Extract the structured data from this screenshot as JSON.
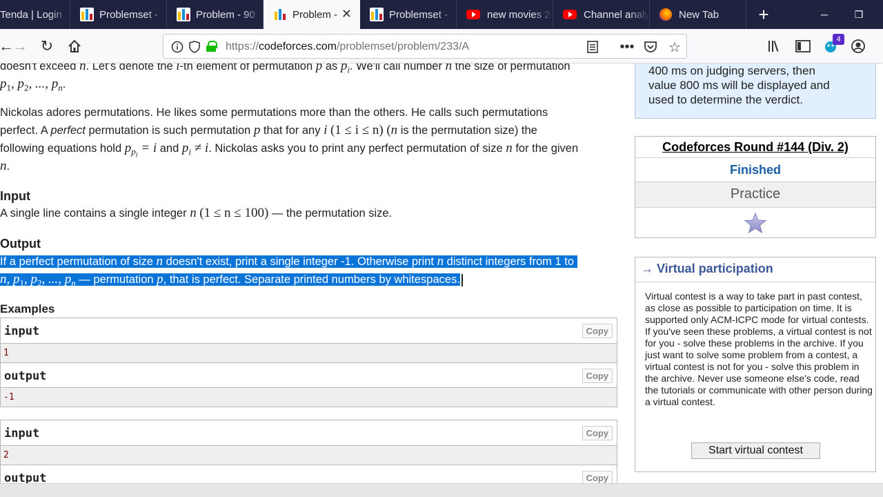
{
  "browser": {
    "tabs": [
      {
        "label": "Tenda | Login",
        "icon": "none"
      },
      {
        "label": "Problemset -",
        "icon": "codeforces-icon"
      },
      {
        "label": "Problem - 90",
        "icon": "codeforces-icon"
      },
      {
        "label": "Problem -",
        "icon": "codeforces-icon",
        "active": true
      },
      {
        "label": "Problemset -",
        "icon": "codeforces-icon"
      },
      {
        "label": "new movies 2",
        "icon": "youtube-icon"
      },
      {
        "label": "Channel analy",
        "icon": "youtube-icon"
      },
      {
        "label": "New Tab",
        "icon": "firefox-icon"
      }
    ],
    "url_prefix": "https://",
    "url_domain": "codeforces.com",
    "url_path": "/problemset/problem/233/A",
    "extension_badge": "4"
  },
  "problem": {
    "p1a_pre": "doesn't exceed",
    "p1a_n": "n",
    "p1a_mid": ". Let's denote the",
    "p1a_i": "i",
    "p1a_mid2": "-th element of permutation",
    "p1a_p": "p",
    "p1a_as": "as",
    "p1a_pi": "p",
    "p1a_sub_i": "i",
    "p1a_post": ". We'll call number",
    "p1a_n2": "n",
    "p1a_end": "the size of permutation",
    "p1b": "p",
    "p1b_1": "1",
    "p1b_comma": ", p",
    "p1b_2": "2",
    "p1b_dots": ", ..., p",
    "p1b_n": "n",
    "p1b_dot": ".",
    "p2_l1": "Nickolas adores permutations. He likes some permutations more than the others. He calls such permutations",
    "p2_l2_a": "perfect. A",
    "p2_l2_perfect": "perfect",
    "p2_l2_b": "permutation is such permutation",
    "p2_l2_p": "p",
    "p2_l2_c": "that for any",
    "p2_l2_i": "i",
    "p2_l2_cond": "(1 ≤ i ≤ n)",
    "p2_l2_d": "(",
    "p2_l2_n": "n",
    "p2_l2_e": "is the permutation size) the",
    "p2_l3_a": "following equations hold",
    "p2_l3_eq1": "p",
    "p2_l3_sub_p": "p",
    "p2_l3_sub_i": "i",
    "p2_l3_eq1b": " = i",
    "p2_l3_and": "and",
    "p2_l3_eq2": "p",
    "p2_l3_eq2_sub": "i",
    "p2_l3_eq2b": " ≠ i",
    "p2_l3_b": ". Nickolas asks you to print any perfect permutation of size",
    "p2_l3_n": "n",
    "p2_l3_c": "for the given",
    "p2_l4": "n",
    "p2_l4_dot": ".",
    "input_heading": "Input",
    "input_a": "A single line contains a single integer",
    "input_n": "n",
    "input_cond": "(1 ≤ n ≤ 100)",
    "input_b": "— the permutation size.",
    "output_heading": "Output",
    "out_l1_a": "If a perfect permutation of size",
    "out_l1_n": "n",
    "out_l1_b": "doesn't exist, print a single integer -1. Otherwise print",
    "out_l1_n2": "n",
    "out_l1_c": "distinct integers from 1 to",
    "out_l2_seq": "n, p",
    "out_l2_1": "1",
    "out_l2_c1": ", p",
    "out_l2_2": "2",
    "out_l2_dots": ", ..., p",
    "out_l2_n": "n",
    "out_l2_b": "— permutation",
    "out_l2_p": "p",
    "out_l2_c": ", that is perfect. Separate printed numbers by whitespaces.",
    "examples_heading": "Examples",
    "copy_label": "Copy",
    "examples": [
      {
        "input_label": "input",
        "input": "1",
        "output_label": "output",
        "output": "-1"
      },
      {
        "input_label": "input",
        "input": "2",
        "output_label": "output",
        "output": ""
      }
    ]
  },
  "sidebar": {
    "note_lines": [
      "400 ms on judging servers, then",
      "value 800 ms will be displayed and",
      "used to determine the verdict."
    ],
    "round_title": "Codeforces Round #144 (Div. 2)",
    "round_status": "Finished",
    "round_mode": "Practice",
    "virtual_title": "→ Virtual participation",
    "virtual_text": "Virtual contest is a way to take part in past contest, as close as possible to participation on time. It is supported only ACM-ICPC mode for virtual contests. If you've seen these problems, a virtual contest is not for you - solve these problems in the archive. If you just want to solve some problem from a contest, a virtual contest is not for you - solve this problem in the archive. Never use someone else's code, read the tutorials or communicate with other person during a virtual contest.",
    "virtual_button": "Start virtual contest"
  }
}
